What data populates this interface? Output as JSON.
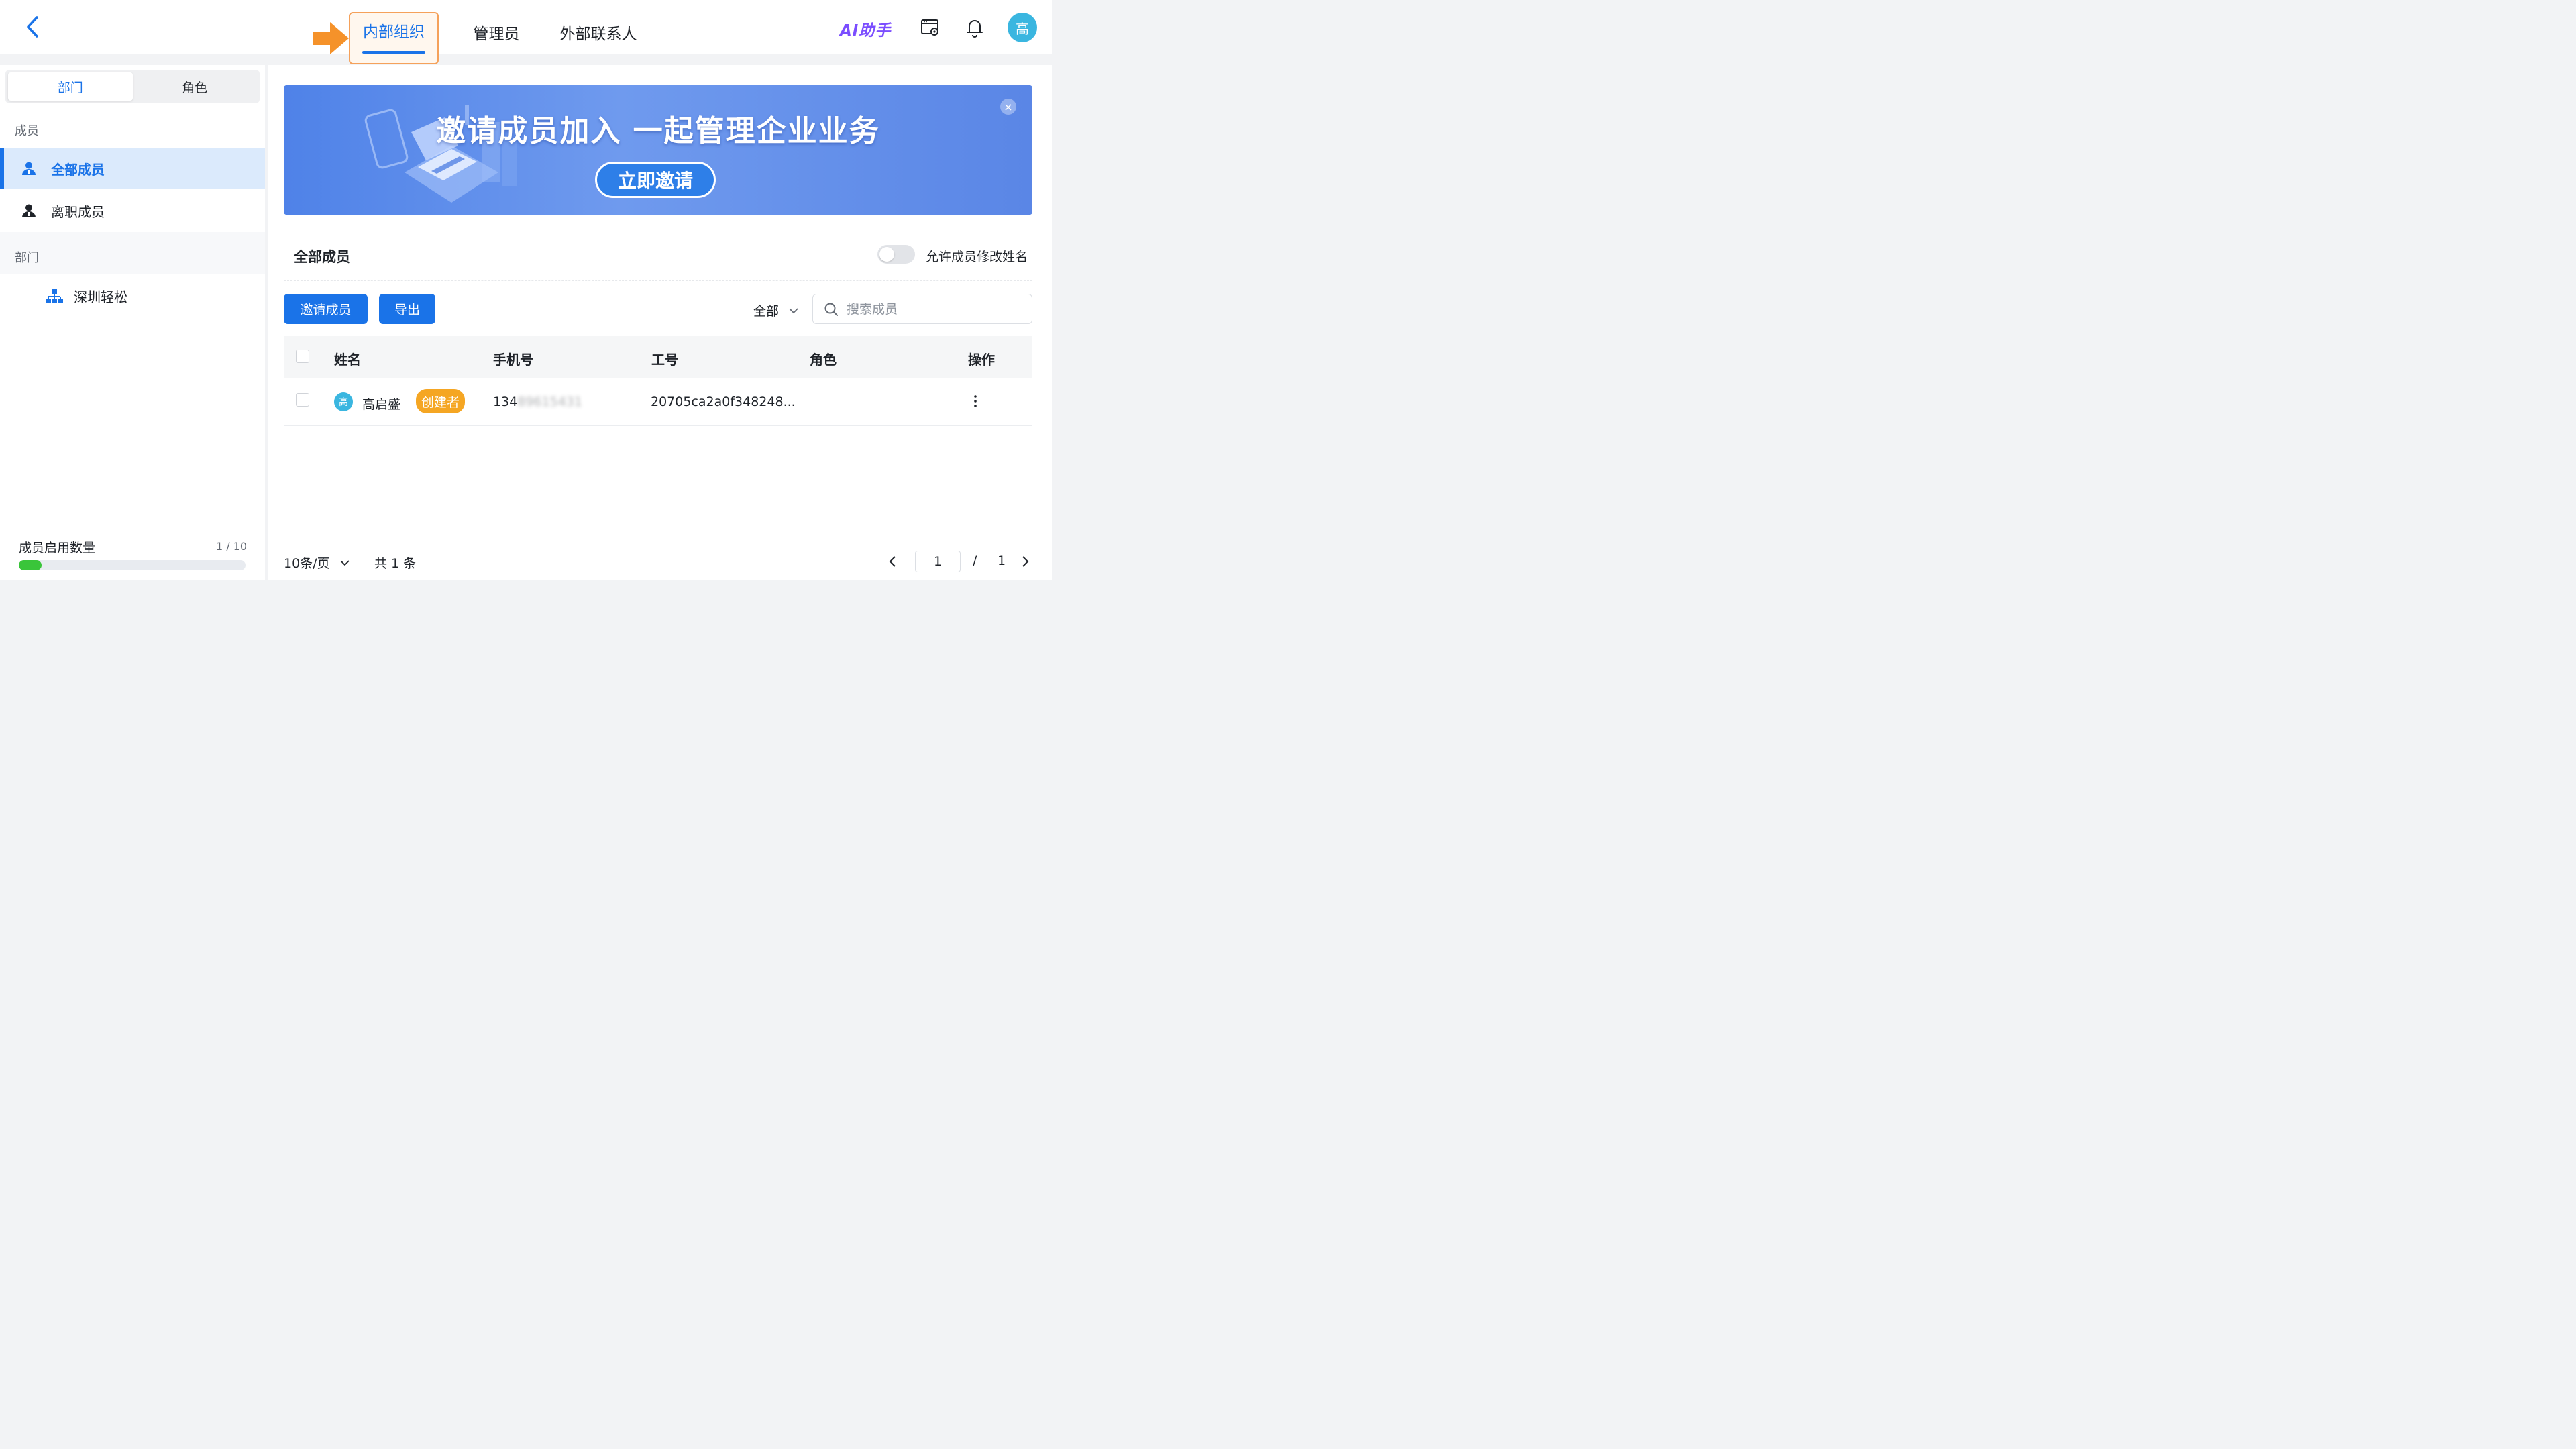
{
  "header": {
    "tabs": [
      {
        "label": "内部组织",
        "active": true
      },
      {
        "label": "管理员",
        "active": false
      },
      {
        "label": "外部联系人",
        "active": false
      }
    ],
    "ai_label": "AI助手",
    "user_avatar": "高",
    "icons": [
      "back-arrow-icon",
      "console-settings-icon",
      "bell-icon"
    ],
    "accent_color": "#1a73e8",
    "highlight_color": "#f5a15a"
  },
  "sidebar": {
    "segments": [
      {
        "label": "部门",
        "active": true
      },
      {
        "label": "角色",
        "active": false
      }
    ],
    "members_section": "成员",
    "member_items": [
      {
        "label": "全部成员",
        "active": true,
        "icon": "user-icon"
      },
      {
        "label": "离职成员",
        "active": false,
        "icon": "user-icon"
      }
    ],
    "dept_section": "部门",
    "dept_item": {
      "label": "深圳轻松",
      "icon": "org-tree-icon"
    },
    "quota": {
      "label": "成员启用数量",
      "value_text": "1 / 10",
      "fraction": 0.1,
      "bar_color": "#3ac53a"
    }
  },
  "banner": {
    "title": "邀请成员加入 一起管理企业业务",
    "button": "立即邀请",
    "close": "×"
  },
  "main": {
    "section_title": "全部成员",
    "toggle_label": "允许成员修改姓名",
    "toggle_on": false,
    "invite_button": "邀请成员",
    "export_button": "导出",
    "filter_label": "全部",
    "search_placeholder": "搜索成员",
    "columns": [
      "姓名",
      "手机号",
      "工号",
      "角色",
      "操作"
    ],
    "rows": [
      {
        "avatar": "高",
        "name": "高启盛",
        "badge": "创建者",
        "phone_visible": "134",
        "phone_hidden": "89615431",
        "employee_id": "20705ca2a0f348248...",
        "role": ""
      }
    ]
  },
  "pagination": {
    "page_size": "10条/页",
    "total": "共 1 条",
    "current_page": "1",
    "separator": "/",
    "total_pages": "1"
  }
}
